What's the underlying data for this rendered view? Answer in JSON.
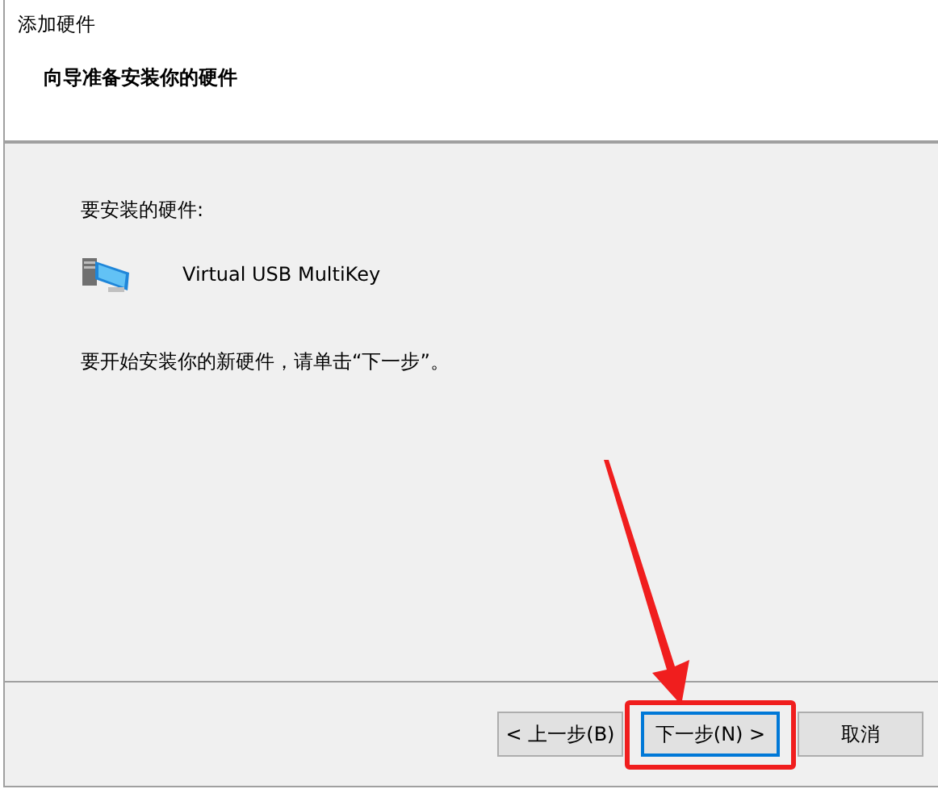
{
  "window": {
    "title": "添加硬件"
  },
  "header": {
    "heading": "向导准备安装你的硬件"
  },
  "body": {
    "hardware_label": "要安装的硬件:",
    "device": {
      "name": "Virtual USB MultiKey"
    },
    "instruction": "要开始安装你的新硬件，请单击“下一步”。"
  },
  "buttons": [
    {
      "label": "< 上一步(B)",
      "default": false,
      "highlighted": false
    },
    {
      "label": "下一步(N) >",
      "default": true,
      "highlighted": true
    },
    {
      "label": "取消",
      "default": false,
      "highlighted": false
    }
  ]
}
